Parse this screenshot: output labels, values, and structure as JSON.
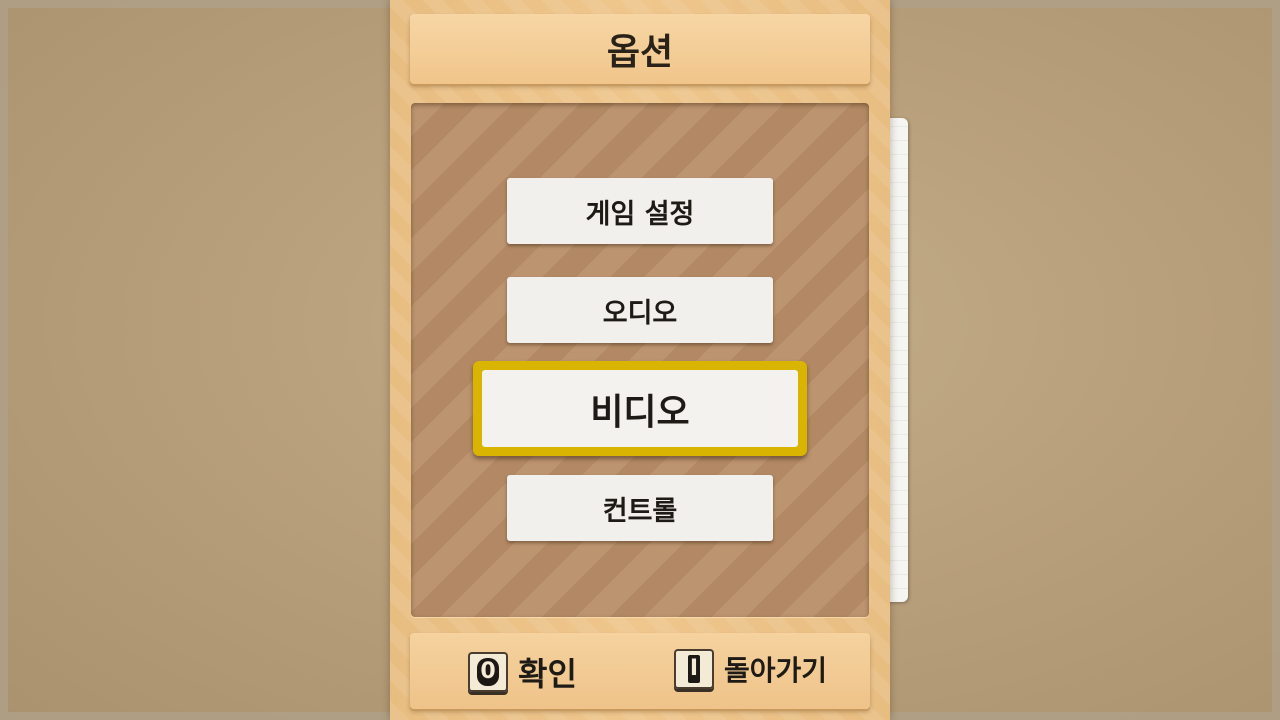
{
  "screen": {
    "title": "옵션"
  },
  "menu": {
    "items": [
      {
        "label": "게임 설정",
        "selected": false
      },
      {
        "label": "오디오",
        "selected": false
      },
      {
        "label": "비디오",
        "selected": true
      },
      {
        "label": "컨트롤",
        "selected": false
      }
    ]
  },
  "footer": {
    "confirm": {
      "key": "0",
      "label": "확인",
      "icon": "button-0-icon"
    },
    "back": {
      "key": "I",
      "label": "돌아가기",
      "icon": "button-1-icon"
    }
  },
  "colors": {
    "panel": "#efc68c",
    "board": "#b88d67",
    "selection": "#d9b400",
    "button": "#f2f0ec"
  }
}
